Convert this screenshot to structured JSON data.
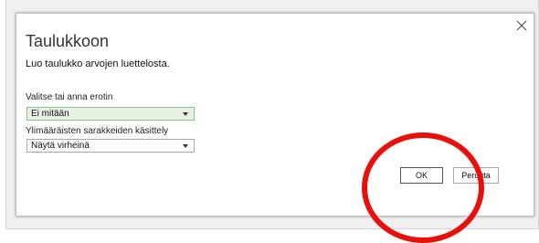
{
  "dialog": {
    "title": "Taulukkoon",
    "description": "Luo taulukko arvojen luettelosta.",
    "separator_label": "Valitse tai anna erotin",
    "separator_value": "Ei mitään",
    "extra_columns_label": "Ylimääräisten sarakkeiden käsittely",
    "extra_columns_value": "Näytä virheinä",
    "ok_label": "OK",
    "cancel_label": "Peruuta",
    "close_icon": "close-icon"
  },
  "colors": {
    "highlight_circle": "#e8100a",
    "active_select_bg": "#e7f2e5"
  }
}
